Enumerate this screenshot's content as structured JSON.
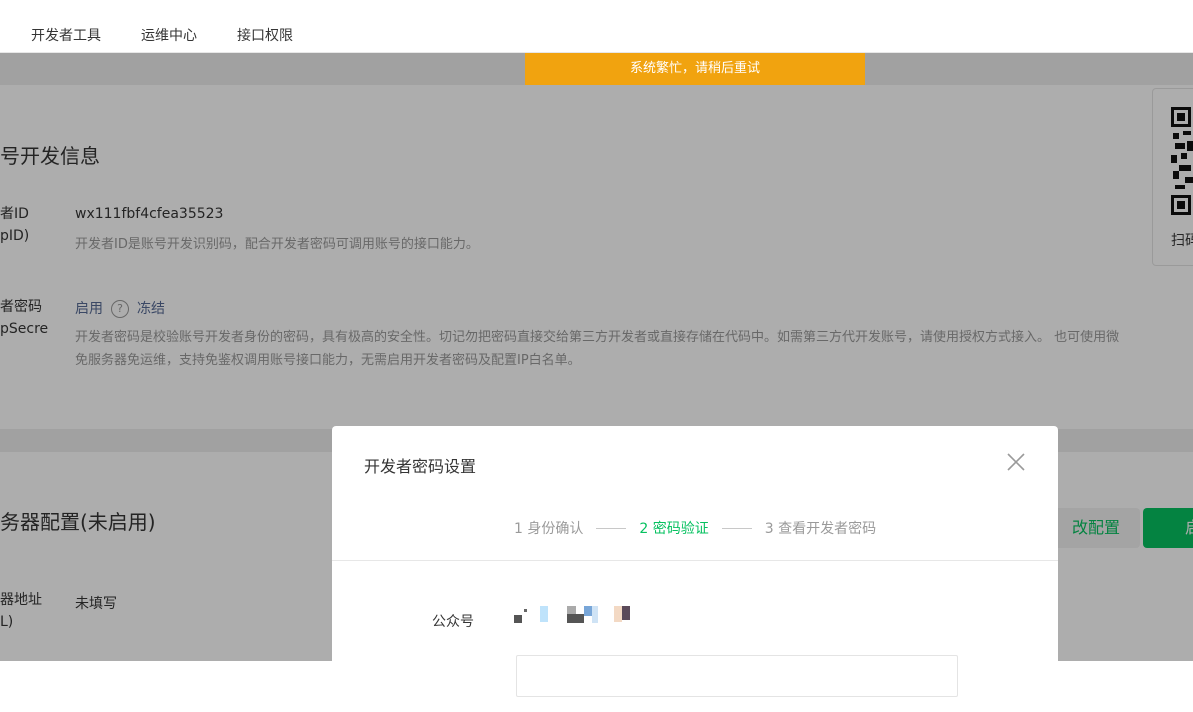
{
  "topnav": {
    "items": [
      "开发者工具",
      "运维中心",
      "接口权限"
    ]
  },
  "toast": {
    "text": "系统繁忙，请稍后重试"
  },
  "dev_info": {
    "title": "号开发信息",
    "appid_label": "者ID\npID)",
    "appid_value": "wx111fbf4cfea35523",
    "appid_desc": "开发者ID是账号开发识别码，配合开发者密码可调用账号的接口能力。",
    "secret_label": "者密码\npSecre",
    "secret_status": "启用",
    "secret_freeze": "冻结",
    "secret_desc_1": "开发者密码是校验账号开发者身份的密码，具有极高的安全性。切记勿把密码直接交给第三方开发者或直接存储在代码中。如需第三方代开发账号，请使用授权方式接入。 也可使用微",
    "secret_desc_2": "免服务器免运维，支持免鉴权调用账号接口能力，无需启用开发者密码及配置IP白名单。"
  },
  "qr": {
    "label": "扫码"
  },
  "server": {
    "title": "务器配置(未启用)",
    "url_label": "器地址\nL)",
    "url_value": "未填写",
    "modify_button": "改配置",
    "enable_button": "启"
  },
  "dialog": {
    "title": "开发者密码设置",
    "steps": [
      "1 身份确认",
      "2 密码验证",
      "3 查看开发者密码"
    ],
    "active_step": 2,
    "account_label": "公众号"
  },
  "colors": {
    "accent": "#07c160",
    "toast_bg": "#f1a30f",
    "link": "#576b95"
  },
  "icons": [
    "help-circle-icon",
    "close-icon",
    "qr-code-icon"
  ]
}
